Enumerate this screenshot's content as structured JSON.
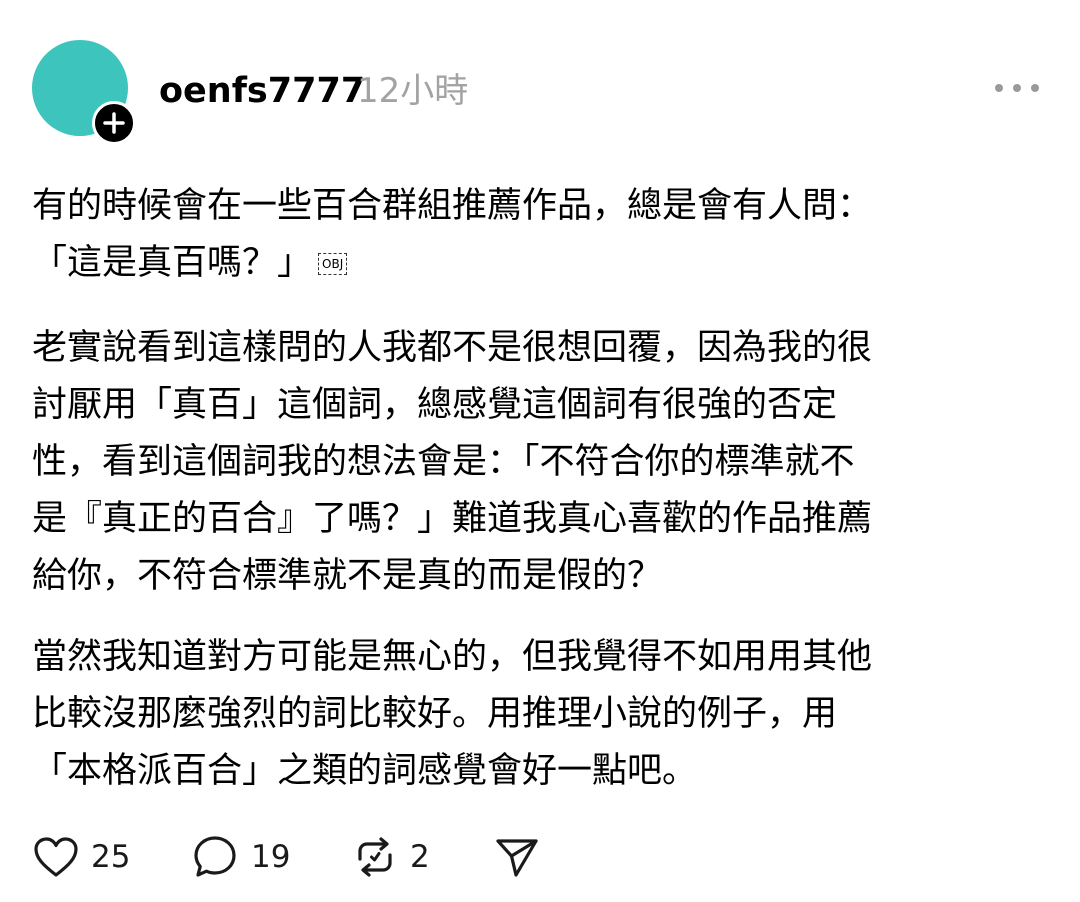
{
  "post": {
    "author": "oenfs7777",
    "time": "12小時",
    "avatar_color": "#3cc4bd",
    "obj_marker": "OBJ",
    "paragraphs": {
      "p1": "有的時候會在一些百合群組推薦作品，總是會有人問：\n「這是真百嗎？」",
      "p2": "老實說看到這樣問的人我都不是很想回覆，因為我的很\n討厭用「真百」這個詞，總感覺這個詞有很強的否定\n性，看到這個詞我的想法會是：「不符合你的標準就不\n是『真正的百合』了嗎？」難道我真心喜歡的作品推薦\n給你，不符合標準就不是真的而是假的？",
      "p3": "當然我知道對方可能是無心的，但我覺得不如用用其他\n比較沒那麼強烈的詞比較好。用推理小說的例子，用\n「本格派百合」之類的詞感覺會好一點吧。"
    }
  },
  "actions": {
    "likes": "25",
    "comments": "19",
    "reposts": "2"
  },
  "icons": {
    "follow": "plus-icon",
    "more": "more-horizontal-icon",
    "like": "heart-icon",
    "comment": "comment-bubble-icon",
    "repost": "repost-icon",
    "share": "send-icon"
  }
}
